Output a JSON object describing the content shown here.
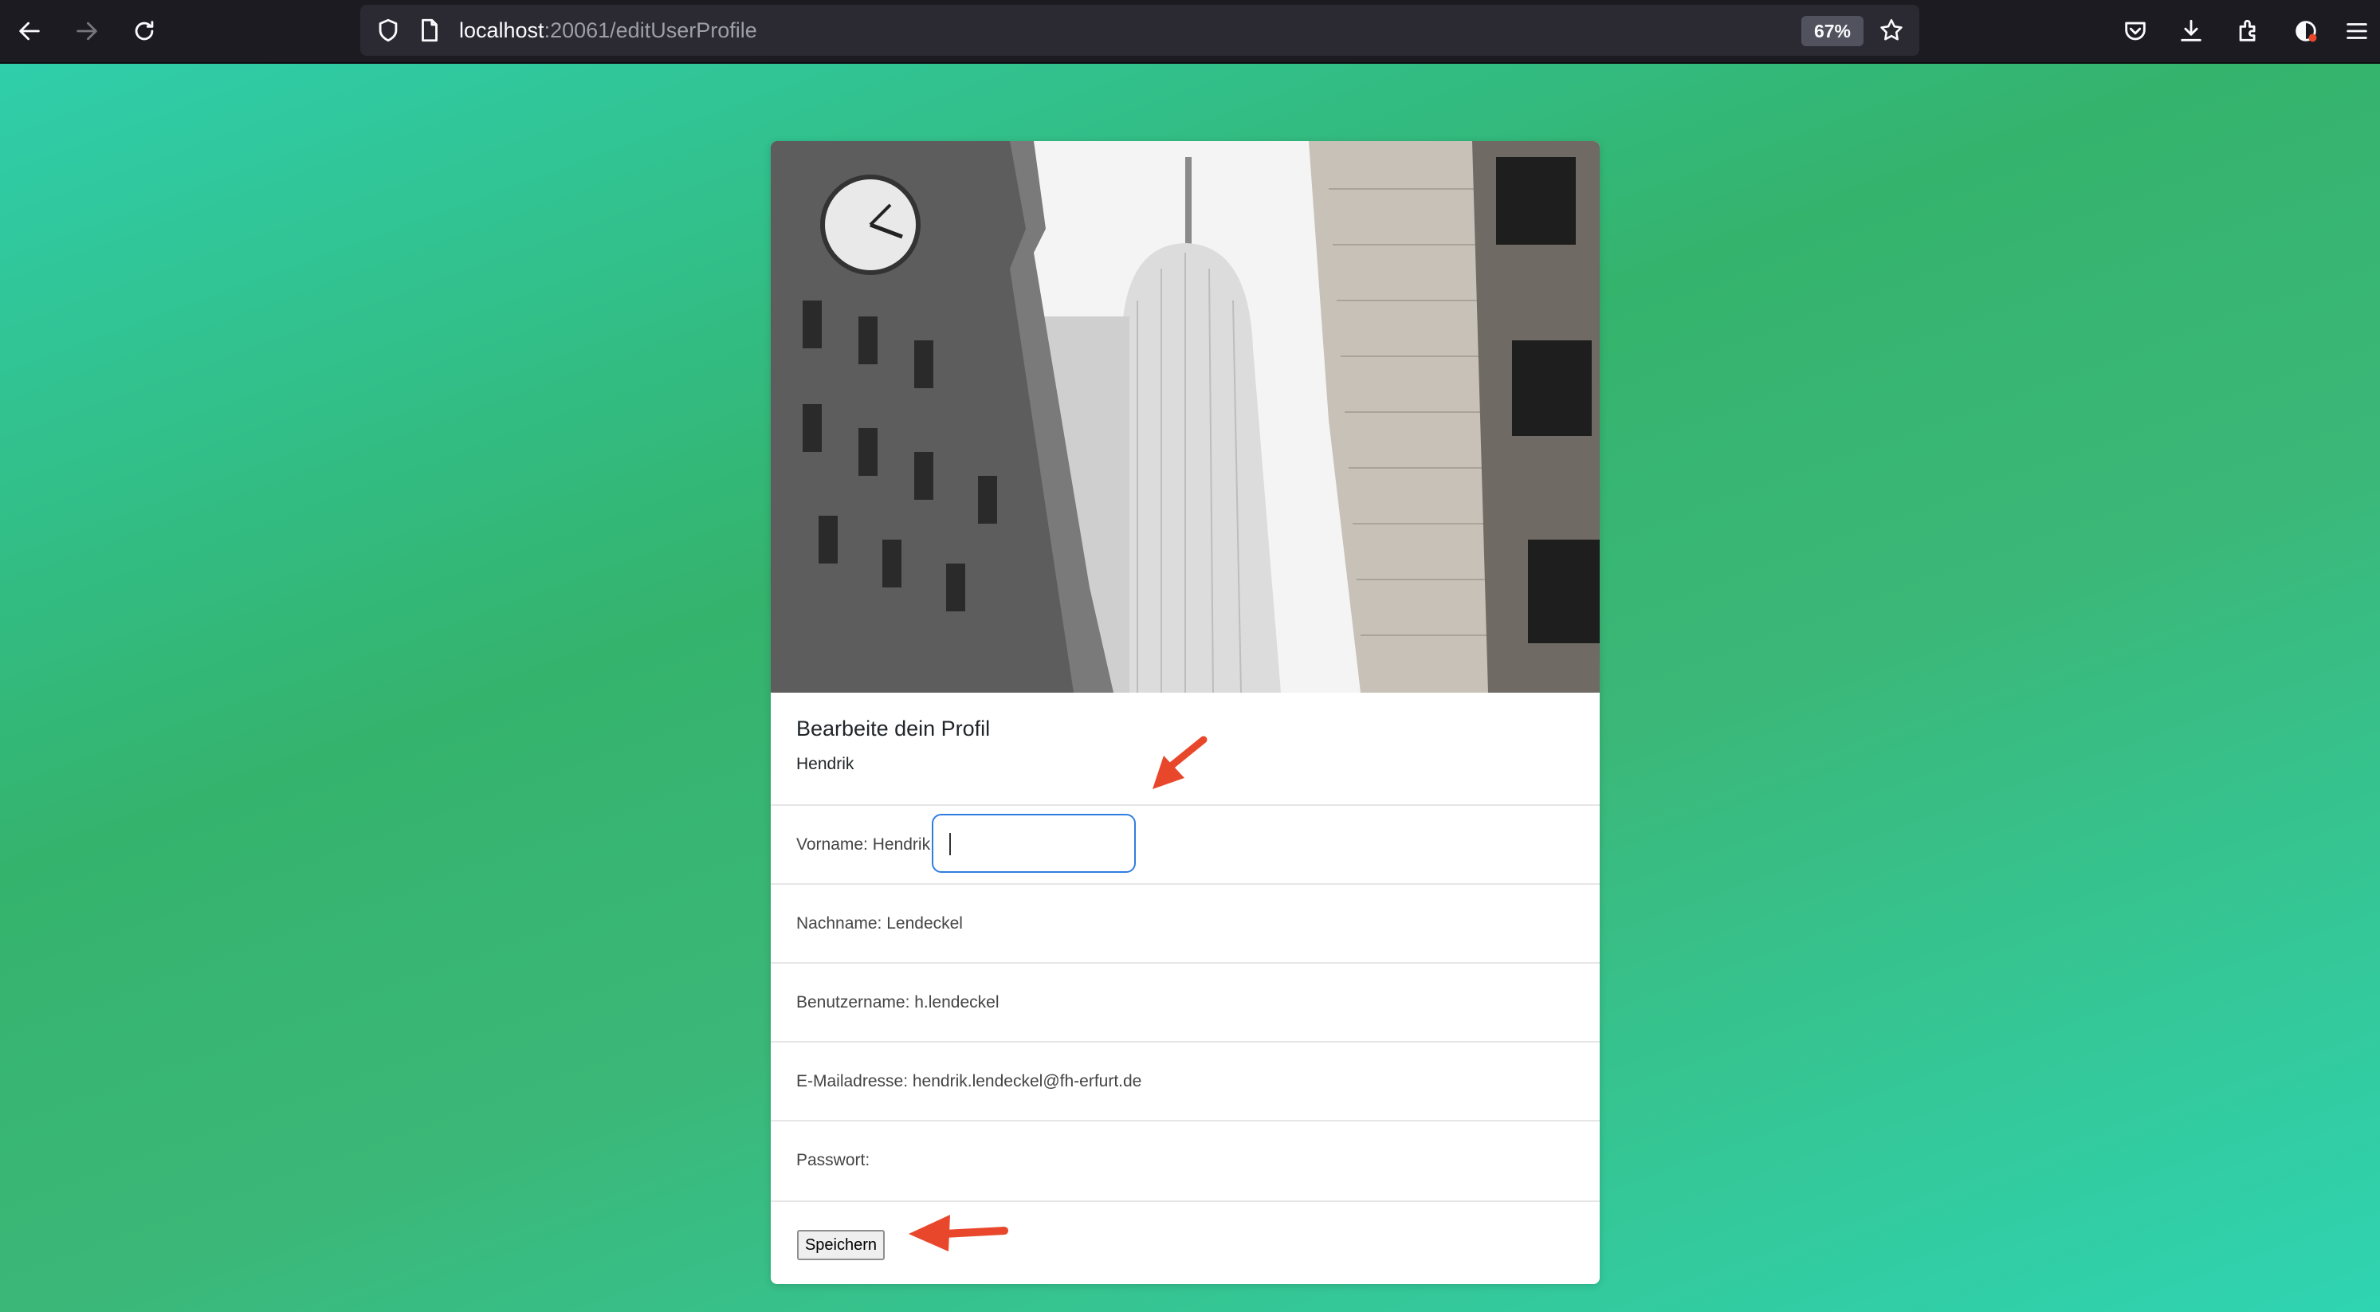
{
  "browser": {
    "url_host": "localhost",
    "url_rest": ":20061/editUserProfile",
    "zoom": "67%",
    "icons": [
      "back-icon",
      "forward-icon",
      "reload-icon",
      "shield-icon",
      "page-icon",
      "star-icon",
      "pocket-icon",
      "download-icon",
      "extensions-icon",
      "account-icon",
      "menu-icon"
    ]
  },
  "card": {
    "title": "Bearbeite dein Profil",
    "subtitle": "Hendrik",
    "fields": [
      {
        "label": "Vorname: Hendrik",
        "input_value": ""
      },
      {
        "label": "Nachname: Lendeckel"
      },
      {
        "label": "Benutzername: h.lendeckel"
      },
      {
        "label": "E-Mailadresse: hendrik.lendeckel@fh-erfurt.de"
      },
      {
        "label": "Passwort:"
      }
    ],
    "save_label": "Speichern"
  },
  "colors": {
    "background_start": "#2fd0b0",
    "background_mid": "#34b36d",
    "toolbar": "#1c1b22",
    "focus_ring": "#2f7de1",
    "annotation_arrow": "#e8472b"
  }
}
